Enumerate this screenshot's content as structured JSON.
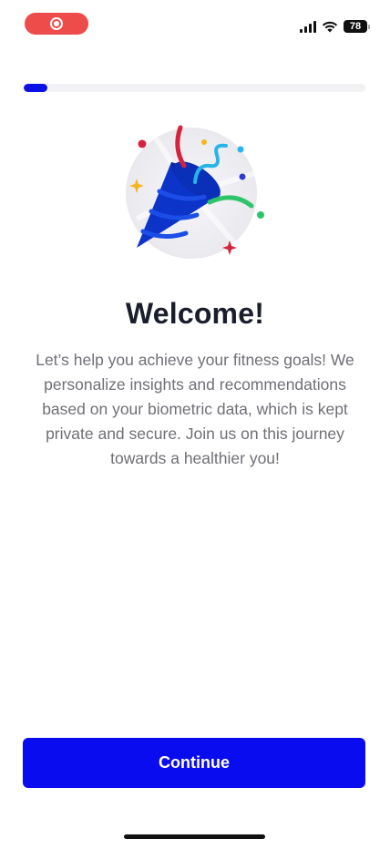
{
  "status_bar": {
    "battery_level": "78",
    "colors": {
      "record_pill": "#ee4b4b"
    },
    "icons": [
      "record-icon",
      "signal-icon",
      "wifi-icon",
      "battery-icon"
    ]
  },
  "onboarding": {
    "progress_fraction": 0.07,
    "illustration": "party-popper-icon",
    "title": "Welcome!",
    "description": "Let’s help you achieve your fitness goals! We personalize insights and recommendations based on your biometric data, which is kept private and secure. Join us on this journey towards a healthier you!",
    "continue_label": "Continue"
  },
  "colors": {
    "accent": "#0a0cf0",
    "progress_track": "#f2f2f5",
    "title_text": "#1a1d2b",
    "body_text": "#6f6f76"
  }
}
